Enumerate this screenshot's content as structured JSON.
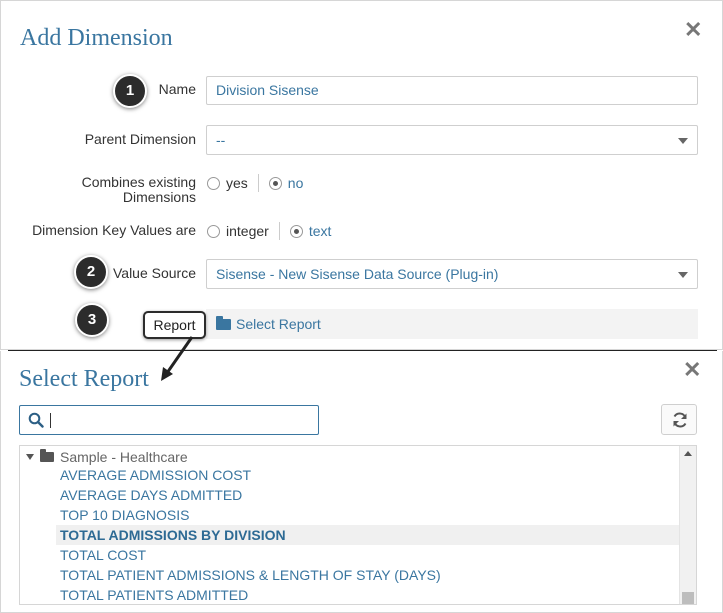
{
  "add_dimension": {
    "title": "Add Dimension",
    "close_glyph": "✕",
    "name": {
      "label": "Name",
      "value": "Division Sisense"
    },
    "parent": {
      "label": "Parent Dimension",
      "value": "--"
    },
    "combines": {
      "label_line1": "Combines existing",
      "label_line2": "Dimensions",
      "opt_yes": "yes",
      "opt_no": "no",
      "selected": "no"
    },
    "key_values": {
      "label": "Dimension Key Values are",
      "opt_integer": "integer",
      "opt_text": "text",
      "selected": "text"
    },
    "value_source": {
      "label": "Value Source",
      "value": "Sisense - New Sisense Data Source (Plug-in)"
    },
    "report": {
      "label": "Report",
      "link": "Select Report"
    }
  },
  "callouts": [
    "1",
    "2",
    "3"
  ],
  "select_report": {
    "title": "Select Report",
    "close_glyph": "✕",
    "search_value": "",
    "tree": {
      "folder": "Sample - Healthcare",
      "items": [
        "AVERAGE ADMISSION COST",
        "AVERAGE DAYS ADMITTED",
        "TOP 10 DIAGNOSIS",
        "TOTAL ADMISSIONS BY DIVISION",
        "TOTAL COST",
        "TOTAL PATIENT ADMISSIONS & LENGTH OF STAY (DAYS)",
        "TOTAL PATIENTS ADMITTED"
      ],
      "highlighted_item": "TOTAL ADMISSIONS BY DIVISION"
    }
  },
  "colors": {
    "accent": "#3a76a0",
    "callout": "#2c2c2c",
    "highlight_row": "#f0f0f0"
  },
  "icons": [
    "close-icon",
    "folder-icon",
    "search-icon",
    "refresh-icon",
    "caret-down-icon",
    "arrow-annotation"
  ]
}
